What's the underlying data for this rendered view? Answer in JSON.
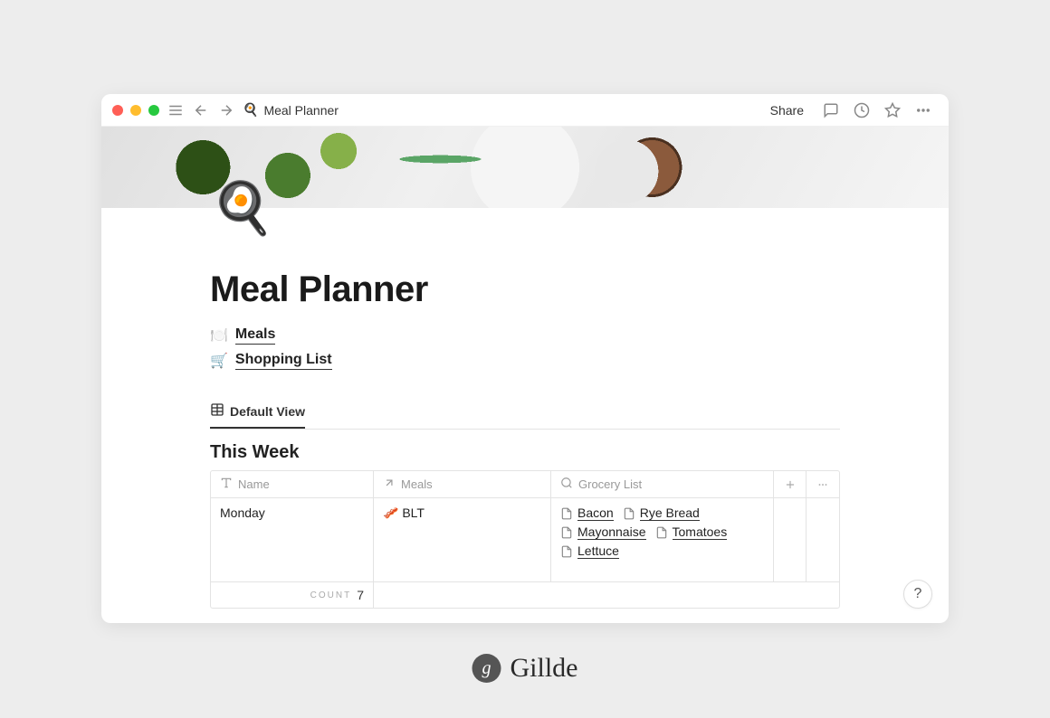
{
  "titlebar": {
    "title": "Meal Planner",
    "icon": "🍳",
    "share_label": "Share"
  },
  "page": {
    "icon": "🍳",
    "title": "Meal Planner",
    "links": [
      {
        "icon": "🍽️",
        "label": "Meals"
      },
      {
        "icon": "🛒",
        "label": "Shopping List"
      }
    ]
  },
  "view": {
    "active_tab": "Default View"
  },
  "section": {
    "title": "This Week"
  },
  "table": {
    "columns": {
      "name": "Name",
      "meals": "Meals",
      "grocery": "Grocery List"
    },
    "rows": [
      {
        "name": "Monday",
        "meal_icon": "🥓",
        "meal": "BLT",
        "grocery": [
          "Bacon",
          "Rye Bread",
          "Mayonnaise",
          "Tomatoes",
          "Lettuce"
        ]
      }
    ],
    "footer": {
      "count_label": "COUNT",
      "count_value": "7"
    }
  },
  "help_label": "?",
  "brand": {
    "icon": "g",
    "name": "Gillde"
  }
}
